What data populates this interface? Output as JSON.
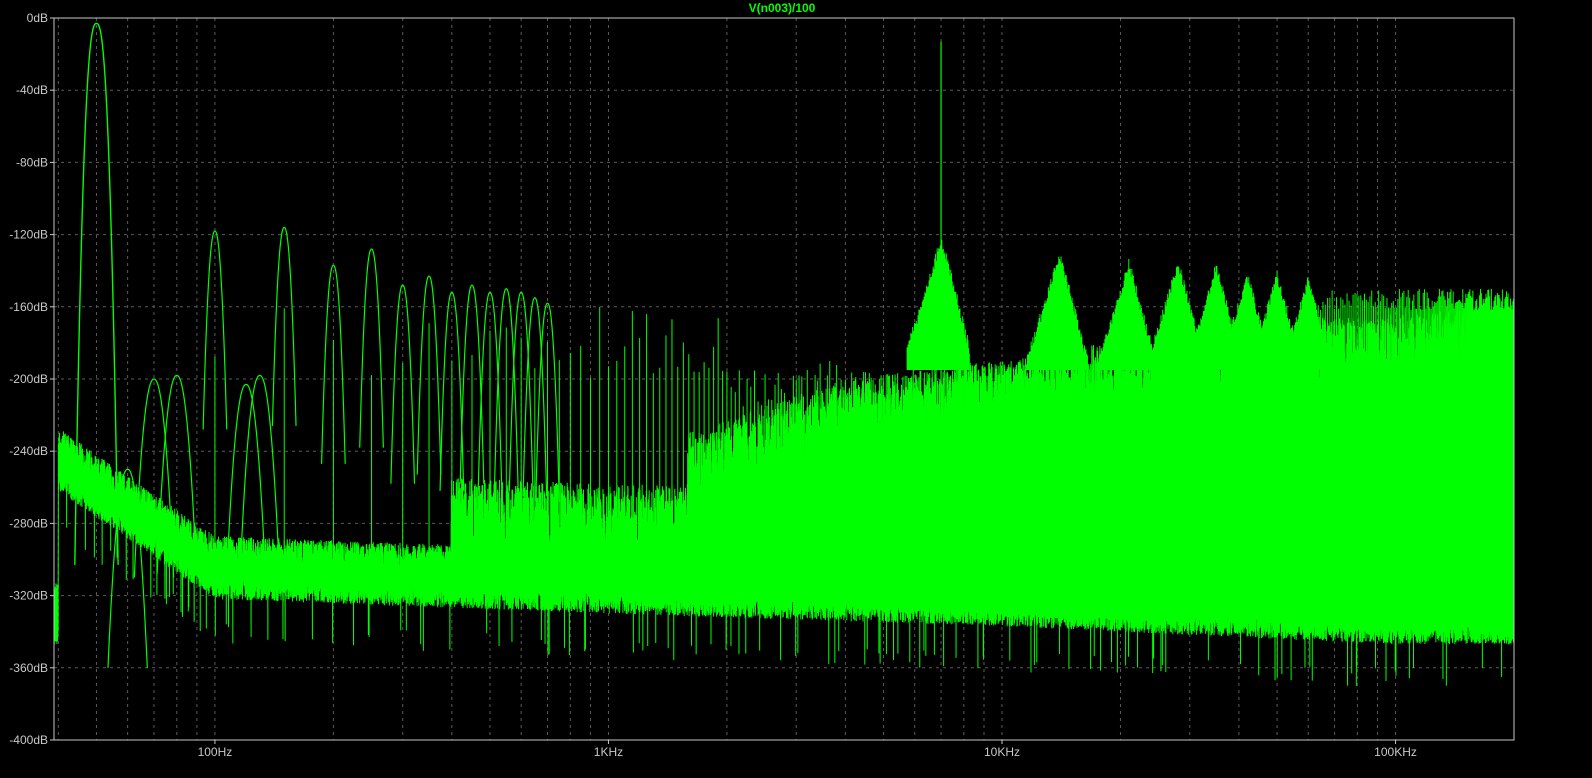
{
  "chart_data": {
    "type": "line",
    "title": "V(n003)/100",
    "xlabel": "",
    "ylabel": "",
    "x_scale": "log",
    "x_unit": "Hz",
    "xlim": [
      39,
      200000
    ],
    "ylim": [
      -400,
      0
    ],
    "grid": true,
    "background_color": "#000000",
    "trace_color": "#00ff00",
    "grid_color": "#5a5a5a",
    "axis_color": "#c8c8c8",
    "y_ticks": [
      {
        "value": 0,
        "label": "0dB"
      },
      {
        "value": -40,
        "label": "-40dB"
      },
      {
        "value": -80,
        "label": "-80dB"
      },
      {
        "value": -120,
        "label": "-120dB"
      },
      {
        "value": -160,
        "label": "-160dB"
      },
      {
        "value": -200,
        "label": "-200dB"
      },
      {
        "value": -240,
        "label": "-240dB"
      },
      {
        "value": -280,
        "label": "-280dB"
      },
      {
        "value": -320,
        "label": "-320dB"
      },
      {
        "value": -360,
        "label": "-360dB"
      },
      {
        "value": -400,
        "label": "-400dB"
      }
    ],
    "x_ticks": [
      {
        "value": 100,
        "label": "100Hz"
      },
      {
        "value": 1000,
        "label": "1KHz"
      },
      {
        "value": 10000,
        "label": "10KHz"
      },
      {
        "value": 100000,
        "label": "100KHz"
      }
    ],
    "series": [
      {
        "name": "V(n003)/100",
        "fundamental": {
          "x": 50,
          "y": -3
        },
        "peaks": [
          {
            "x": 100,
            "y": -118
          },
          {
            "x": 150,
            "y": -116
          },
          {
            "x": 200,
            "y": -137
          },
          {
            "x": 250,
            "y": -128
          },
          {
            "x": 300,
            "y": -148
          },
          {
            "x": 350,
            "y": -143
          },
          {
            "x": 400,
            "y": -152
          },
          {
            "x": 450,
            "y": -148
          },
          {
            "x": 500,
            "y": -152
          },
          {
            "x": 550,
            "y": -150
          },
          {
            "x": 600,
            "y": -152
          },
          {
            "x": 650,
            "y": -155
          },
          {
            "x": 700,
            "y": -158
          },
          {
            "x": 7000,
            "y": -13
          },
          {
            "x": 14000,
            "y": -128
          },
          {
            "x": 21000,
            "y": -133
          },
          {
            "x": 28000,
            "y": -133
          },
          {
            "x": 35000,
            "y": -135
          },
          {
            "x": 42000,
            "y": -140
          },
          {
            "x": 50000,
            "y": -140
          },
          {
            "x": 60000,
            "y": -142
          }
        ],
        "sidebands": [
          {
            "x": 70,
            "y": -200
          },
          {
            "x": 80,
            "y": -198
          },
          {
            "x": 120,
            "y": -203
          },
          {
            "x": 130,
            "y": -198
          },
          {
            "x": 60,
            "y": -250
          }
        ],
        "noise_floor": [
          {
            "x": 40,
            "y": -250
          },
          {
            "x": 100,
            "y": -310
          },
          {
            "x": 1000,
            "y": -318
          },
          {
            "x": 10000,
            "y": -325
          },
          {
            "x": 100000,
            "y": -335
          },
          {
            "x": 200000,
            "y": -335
          }
        ]
      }
    ]
  }
}
